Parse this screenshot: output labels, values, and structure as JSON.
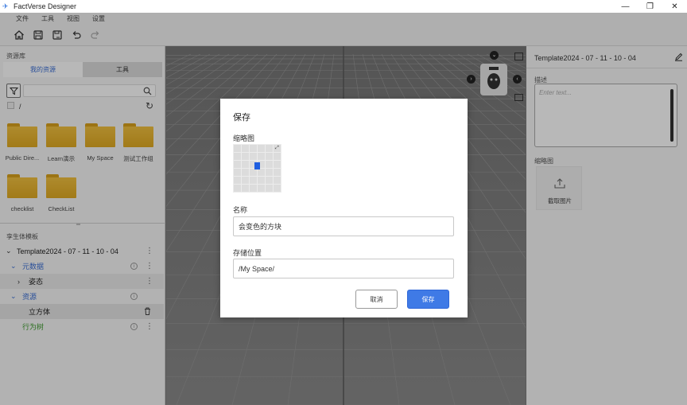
{
  "app": {
    "title": "FactVerse Designer",
    "window_controls": [
      "—",
      "❐",
      "✕"
    ]
  },
  "menu": [
    "文件",
    "工具",
    "视图",
    "设置"
  ],
  "toolbar": {
    "icons": [
      "home-icon",
      "save-icon",
      "save-as-icon",
      "undo-icon",
      "redo-icon"
    ]
  },
  "left_panel": {
    "header": "资源库",
    "tabs": [
      {
        "label": "我的资源",
        "active": true
      },
      {
        "label": "工具",
        "active": false
      }
    ],
    "path": "/",
    "folders": [
      {
        "label": "Public Dire..."
      },
      {
        "label": "Learn演示"
      },
      {
        "label": "My Space"
      },
      {
        "label": "测试工作组"
      },
      {
        "label": "checklist"
      },
      {
        "label": "CheckList"
      }
    ],
    "tree_header": "孪生体模板",
    "tree": [
      {
        "label": "Template2024 - 07 - 11 - 10 - 04",
        "color": "#222222"
      },
      {
        "label": "元数据",
        "color": "#3b6fd6"
      },
      {
        "label": "姿态",
        "color": "#222222"
      },
      {
        "label": "资源",
        "color": "#3b6fd6"
      },
      {
        "label": "立方体",
        "color": "#222222"
      },
      {
        "label": "行为树",
        "color": "#3a9a2a"
      }
    ]
  },
  "right_panel": {
    "title": "Template2024 - 07 - 11 - 10 - 04",
    "desc_label": "描述",
    "desc_placeholder": "Enter text...",
    "thumb_label": "缩略图",
    "capture_label": "截取图片"
  },
  "dialog": {
    "title": "保存",
    "thumb_label": "缩略图",
    "name_label": "名称",
    "name_value": "会变色的方块",
    "location_label": "存储位置",
    "location_value": "/My Space/",
    "cancel_label": "取消",
    "save_label": "保存"
  },
  "colors": {
    "accent": "#3f7ae6",
    "tab_active_text": "#3b6fd6",
    "folder": "#e9b531",
    "tree_green": "#3a9a2a"
  }
}
